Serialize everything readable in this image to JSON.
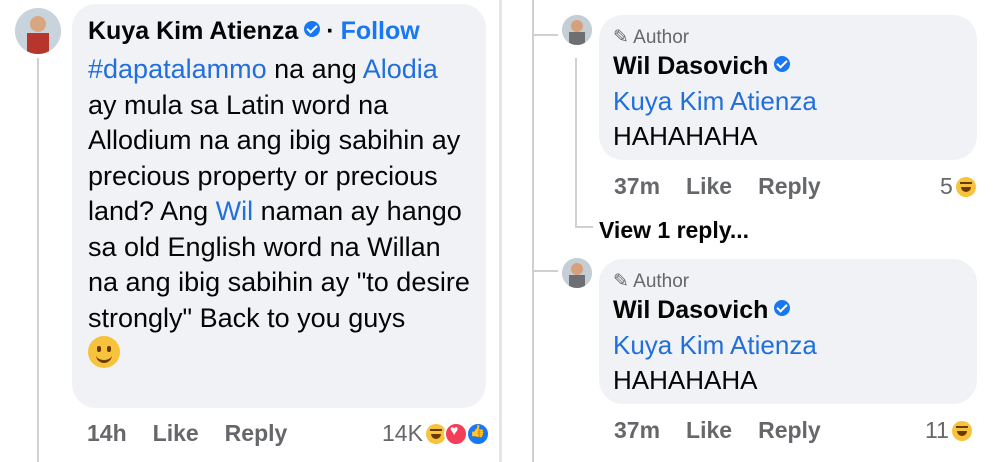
{
  "main_comment": {
    "author": "Kuya Kim Atienza",
    "follow": "Follow",
    "text_parts": {
      "hashtag": "#dapatalammo",
      "t1": " na ang",
      "mention1": "Alodia",
      "t2": " ay mula sa Latin word na Allodium na ang ibig sabihin ay precious property or precious land? Ang ",
      "mention2": "Wil",
      "t3": " naman ay hango sa old English word na Willan na ang ibig sabihin ay \"to desire strongly\"  Back to you guys "
    },
    "time": "14h",
    "like": "Like",
    "reply": "Reply",
    "reaction_count": "14K",
    "reactions": [
      "haha",
      "heart",
      "like"
    ]
  },
  "replies": [
    {
      "badge": "Author",
      "author": "Wil Dasovich",
      "mention": "Kuya Kim Atienza",
      "text": "HAHAHAHA",
      "time": "37m",
      "like": "Like",
      "reply": "Reply",
      "reaction_count": "5",
      "view_replies": "View 1 reply..."
    },
    {
      "badge": "Author",
      "author": "Wil Dasovich",
      "mention": "Kuya Kim Atienza",
      "text": "HAHAHAHA",
      "time": "37m",
      "like": "Like",
      "reply": "Reply",
      "reaction_count": "11"
    }
  ],
  "colors": {
    "link": "#216fdb",
    "follow": "#1877f2",
    "bubble": "#f0f2f5",
    "meta": "#65676b"
  }
}
